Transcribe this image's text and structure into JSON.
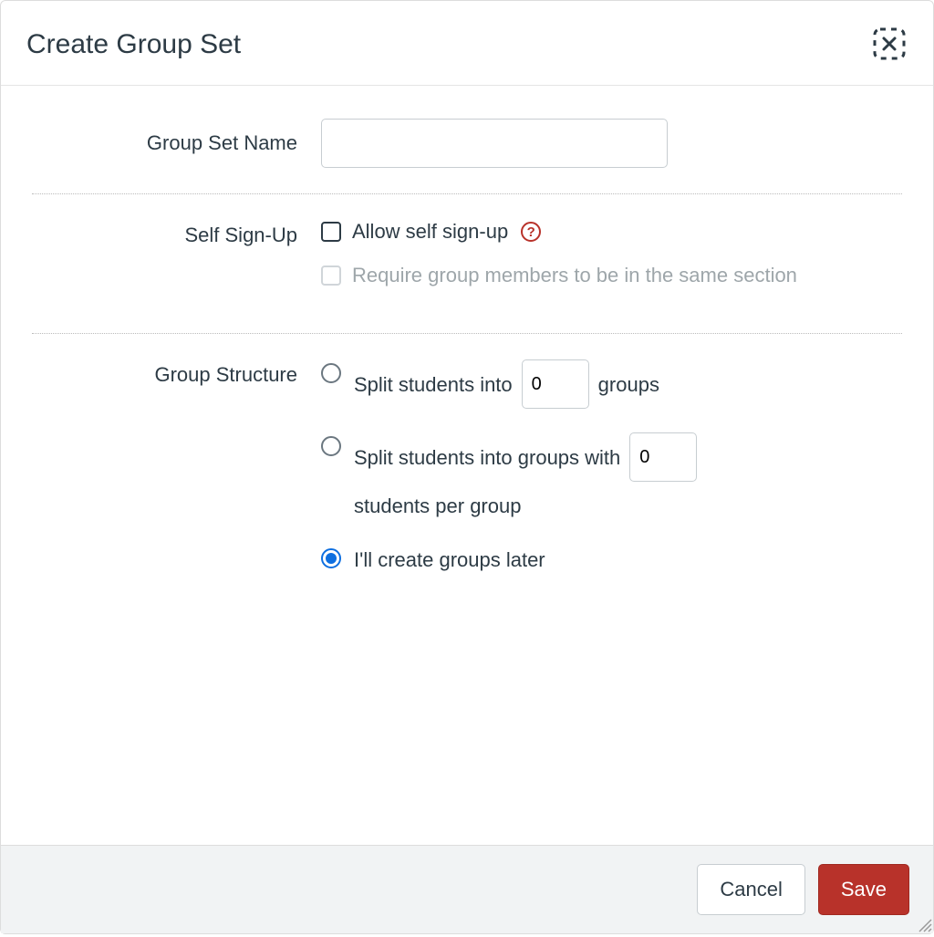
{
  "modal": {
    "title": "Create Group Set"
  },
  "form": {
    "group_set_name": {
      "label": "Group Set Name",
      "value": ""
    },
    "self_sign_up": {
      "label": "Self Sign-Up",
      "allow_label": "Allow self sign-up",
      "require_same_section_label": "Require group members to be in the same section"
    },
    "group_structure": {
      "label": "Group Structure",
      "split_into_prefix": "Split students into",
      "split_into_suffix": "groups",
      "split_into_value": "0",
      "split_with_prefix": "Split students into groups with",
      "split_with_suffix": "students per group",
      "split_with_value": "0",
      "create_later_label": "I'll create groups later"
    }
  },
  "footer": {
    "cancel_label": "Cancel",
    "save_label": "Save"
  },
  "icons": {
    "help_glyph": "?"
  }
}
